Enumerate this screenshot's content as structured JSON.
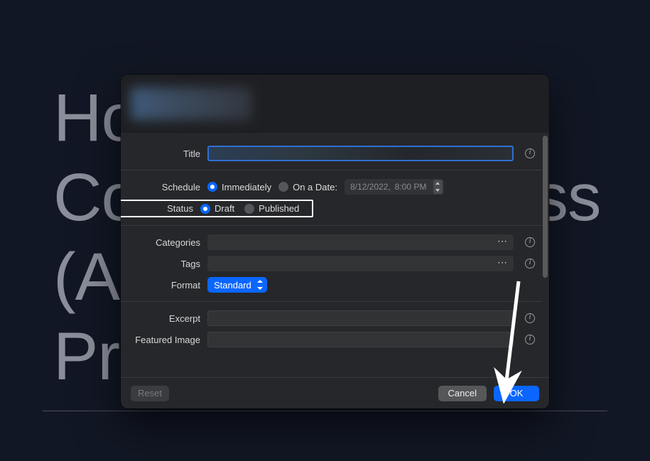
{
  "background": {
    "line1": "Ho",
    "line2": "Co",
    "line2b": "ss",
    "line3": "(A",
    "line4": "Pr"
  },
  "dialog": {
    "labels": {
      "title": "Title",
      "schedule": "Schedule",
      "status": "Status",
      "categories": "Categories",
      "tags": "Tags",
      "format": "Format",
      "excerpt": "Excerpt",
      "featured_image": "Featured Image"
    },
    "schedule": {
      "immediately": "Immediately",
      "on_a_date": "On a Date:",
      "date": "8/12/2022,",
      "time": "8:00 PM"
    },
    "status": {
      "draft": "Draft",
      "published": "Published"
    },
    "format": {
      "selected": "Standard"
    },
    "buttons": {
      "reset": "Reset",
      "cancel": "Cancel",
      "ok": "OK"
    }
  }
}
